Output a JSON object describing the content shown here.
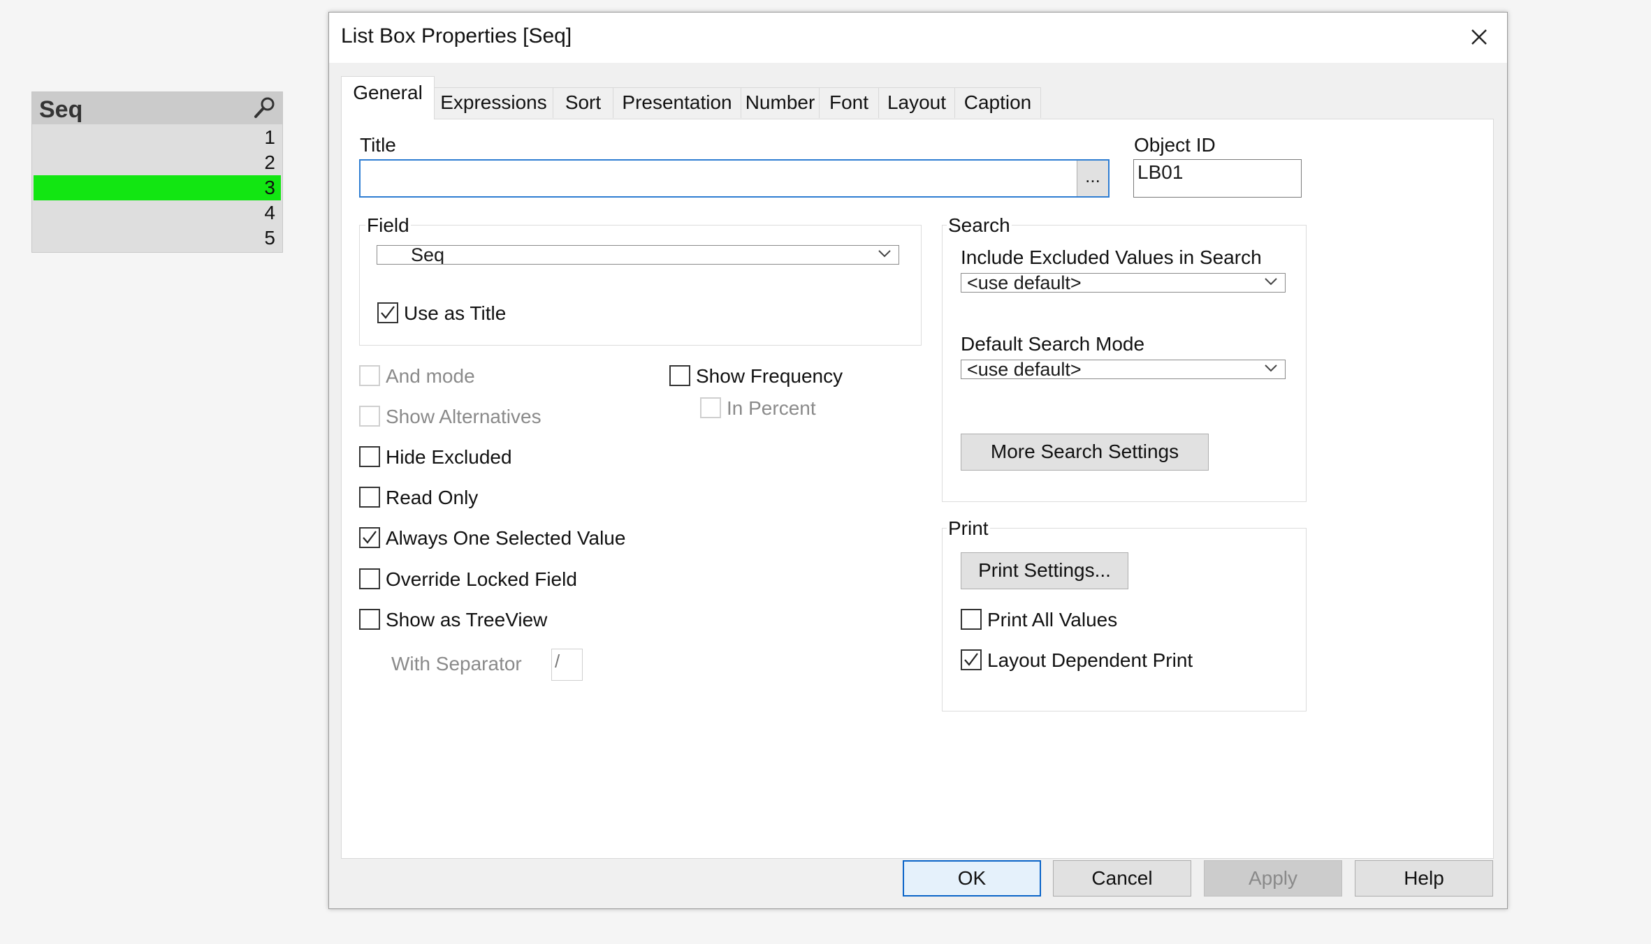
{
  "listbox": {
    "title": "Seq",
    "icon": "search-icon",
    "rows": [
      "1",
      "2",
      "3",
      "4",
      "5"
    ],
    "selected_index": 2,
    "selected_color": "#12e612"
  },
  "dialog": {
    "title": "List Box Properties [Seq]",
    "tabs": [
      "General",
      "Expressions",
      "Sort",
      "Presentation",
      "Number",
      "Font",
      "Layout",
      "Caption"
    ],
    "active_tab": "General",
    "title_label": "Title",
    "title_value": "",
    "title_ellipsis": "...",
    "object_id_label": "Object ID",
    "object_id_value": "LB01",
    "field_group": "Field",
    "field_value": "Seq",
    "use_as_title": "Use as Title",
    "and_mode": "And mode",
    "show_alternatives": "Show Alternatives",
    "hide_excluded": "Hide Excluded",
    "read_only": "Read Only",
    "always_one_selected": "Always One Selected Value",
    "override_locked": "Override Locked Field",
    "show_as_treeview": "Show as TreeView",
    "with_separator": "With Separator",
    "separator_value": "/",
    "show_frequency": "Show Frequency",
    "in_percent": "In Percent",
    "search_group": "Search",
    "include_excluded_label": "Include Excluded Values in Search",
    "include_excluded_value": "<use default>",
    "default_search_mode_label": "Default Search Mode",
    "default_search_mode_value": "<use default>",
    "more_search_settings": "More Search Settings",
    "print_group": "Print",
    "print_settings": "Print Settings...",
    "print_all_values": "Print All Values",
    "layout_dependent_print": "Layout Dependent Print",
    "buttons": {
      "ok": "OK",
      "cancel": "Cancel",
      "apply": "Apply",
      "help": "Help"
    },
    "accent": "#0a64c8"
  }
}
